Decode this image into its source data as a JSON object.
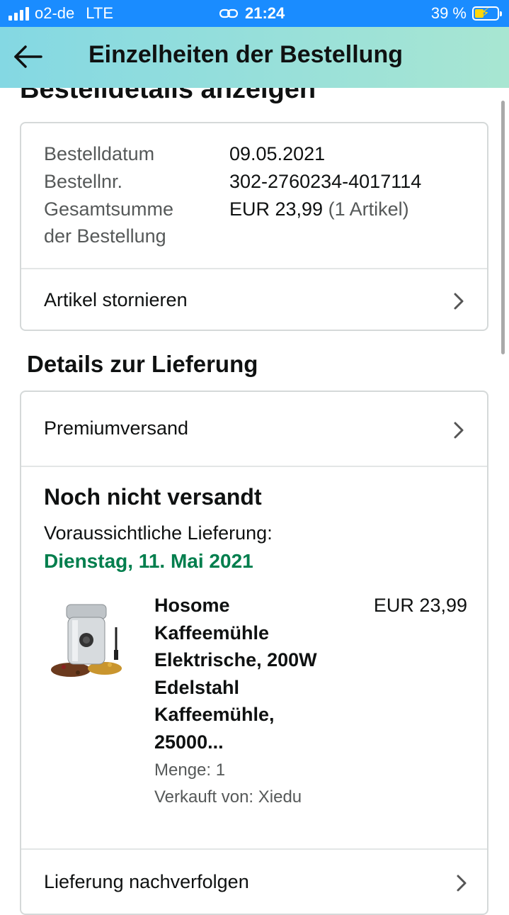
{
  "status_bar": {
    "carrier": "o2-de",
    "network": "LTE",
    "time": "21:24",
    "battery": "39 %",
    "icons": [
      "signal-icon",
      "link-icon",
      "battery-charging-icon"
    ]
  },
  "header": {
    "title": "Einzelheiten der Bestellung",
    "back_icon": "arrow-left-icon"
  },
  "page": {
    "clipped_title": "Bestelldetails anzeigen"
  },
  "order_summary": {
    "date_label": "Bestelldatum",
    "date_value": "09.05.2021",
    "number_label": "Bestellnr.",
    "number_value": "302-2760234-4017114",
    "total_label_line1": "Gesamtsumme",
    "total_label_line2": "der Bestellung",
    "total_value": "EUR 23,99",
    "total_items": "(1 Artikel)",
    "cancel_label": "Artikel stornieren"
  },
  "delivery": {
    "section_title": "Details zur Lieferung",
    "shipping_method": "Premiumversand",
    "status": "Noch nicht versandt",
    "eta_label": "Voraussichtliche Lieferung:",
    "eta_date": "Dienstag, 11. Mai 2021",
    "product": {
      "title_lines": [
        "Hosome",
        "Kaffeemühle",
        "Elektrische, 200W",
        "Edelstahl",
        "Kaffeemühle,",
        "25000..."
      ],
      "price": "EUR 23,99",
      "quantity": "Menge: 1",
      "seller": "Verkauft von: Xiedu"
    },
    "track_label": "Lieferung nachverfolgen"
  },
  "colors": {
    "status_bar": "#1a8cff",
    "header_gradient_start": "#84d8e3",
    "header_gradient_end": "#a8e6d2",
    "eta_green": "#007e4d",
    "muted_text": "#565959",
    "border": "#d5d9d9"
  }
}
